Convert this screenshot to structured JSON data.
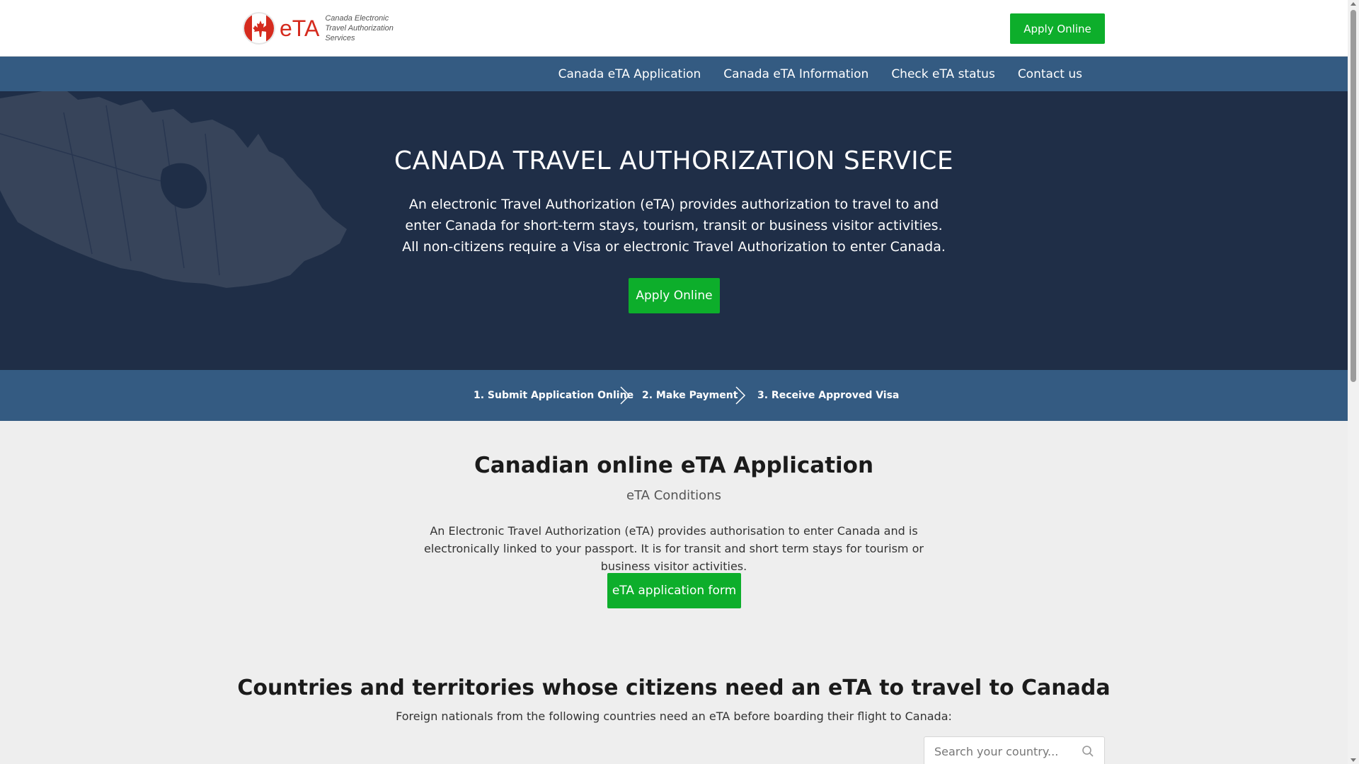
{
  "header": {
    "logo_text": "eTA",
    "logo_subtitle": "Canada Electronic Travel Authorization Services",
    "apply_label": "Apply Online"
  },
  "nav": {
    "items": [
      {
        "label": "Canada eTA Application"
      },
      {
        "label": "Canada eTA Information"
      },
      {
        "label": "Check eTA status"
      },
      {
        "label": "Contact us"
      }
    ]
  },
  "hero": {
    "title": "CANADA TRAVEL AUTHORIZATION SERVICE",
    "text": "An electronic Travel Authorization (eTA) provides authorization to travel to and enter Canada for short-term stays, tourism, transit or business visitor activities. All non-citizens require a Visa or electronic Travel Authorization to enter Canada.",
    "apply_label": "Apply Online"
  },
  "steps": [
    {
      "label": "1. Submit Application Online"
    },
    {
      "label": "2. Make Payment"
    },
    {
      "label": "3. Receive Approved Visa"
    }
  ],
  "application": {
    "title": "Canadian online eTA Application",
    "subtitle": "eTA Conditions",
    "text": "An Electronic Travel Authorization (eTA) provides authorisation to enter Canada and is electronically linked to your passport. It is for transit and short term stays for tourism or business visitor activities.",
    "button_label": "eTA application form"
  },
  "countries": {
    "title": "Countries and territories whose citizens need an eTA to travel to Canada",
    "subtitle": "Foreign nationals from the following countries need an eTA before boarding their flight to Canada:",
    "search_placeholder": "Search your country..."
  },
  "colors": {
    "accent_green": "#0dae2b",
    "nav_blue": "#345b82",
    "hero_navy": "#1f2e47",
    "brand_red": "#d52b1e"
  }
}
